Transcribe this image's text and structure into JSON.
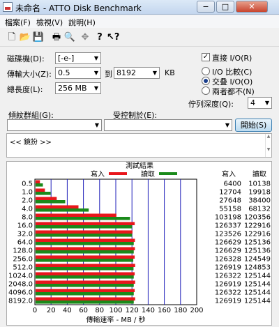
{
  "window": {
    "title": "未命名 - ATTO Disk Benchmark",
    "min": "−",
    "max": "□",
    "close": "✕"
  },
  "menu": [
    "檔案(F)",
    "檢視(V)",
    "說明(H)"
  ],
  "toolbar_icons": [
    "new-icon",
    "open-icon",
    "save-icon",
    "print-icon",
    "print-preview-icon",
    "move-icon",
    "help-icon",
    "context-help-icon"
  ],
  "form": {
    "drive_label": "磁碟機(D):",
    "drive_value": "[-e-]",
    "transfer_label": "傳輸大小(Z):",
    "transfer_from": "0.5",
    "to_label": "到",
    "transfer_to": "8192",
    "unit": "KB",
    "length_label": "總長度(L):",
    "length_value": "256 MB",
    "direct_io": "直接 I/O(R)",
    "direct_checked": "✓",
    "io_compare": "I/O 比較(C)",
    "overlapped_io": "交叠 I/O(O)",
    "neither": "兩者都不(N)",
    "queue_label": "佇列深度(Q):",
    "queue_value": "4",
    "controlled_by_label": "傾紋群組(G):",
    "controlled_label": "受控制於(E):",
    "start_button": "開始(S)",
    "description": "<< 鏡扮 >>"
  },
  "chart_data": {
    "type": "bar",
    "title": "測試結果",
    "legend": [
      {
        "name": "寫入",
        "color": "#e8161b"
      },
      {
        "name": "讀取",
        "color": "#1a8a1a"
      }
    ],
    "xlabel": "傳輸速率 - MB / 秒",
    "xlim": [
      0,
      200
    ],
    "xticks": [
      "0",
      "20",
      "40",
      "60",
      "80",
      "100",
      "120",
      "140",
      "160",
      "180",
      "200"
    ],
    "col_write_header": "寫入",
    "col_read_header": "讀取",
    "categories": [
      "0.5",
      "1.0",
      "2.0",
      "4.0",
      "8.0",
      "16.0",
      "32.0",
      "64.0",
      "128.0",
      "256.0",
      "512.0",
      "1024.0",
      "2048.0",
      "4096.0",
      "8192.0"
    ],
    "write_raw": [
      "6400",
      "12704",
      "27648",
      "55158",
      "103198",
      "126337",
      "123526",
      "126629",
      "126629",
      "126328",
      "126919",
      "126322",
      "126919",
      "126322",
      "126919"
    ],
    "read_raw": [
      "10138",
      "19918",
      "38400",
      "68132",
      "120356",
      "122916",
      "122916",
      "125136",
      "125136",
      "124549",
      "124853",
      "125144",
      "125144",
      "125144",
      "125144"
    ],
    "series": [
      {
        "name": "寫入",
        "values": [
          6.25,
          12.41,
          27.0,
          53.87,
          100.78,
          123.38,
          120.63,
          123.66,
          123.66,
          123.37,
          123.94,
          123.36,
          123.94,
          123.36,
          123.94
        ]
      },
      {
        "name": "讀取",
        "values": [
          9.9,
          19.45,
          37.5,
          66.54,
          117.54,
          120.04,
          120.04,
          122.2,
          122.2,
          121.63,
          121.93,
          122.21,
          122.21,
          122.21,
          122.21
        ]
      }
    ]
  }
}
